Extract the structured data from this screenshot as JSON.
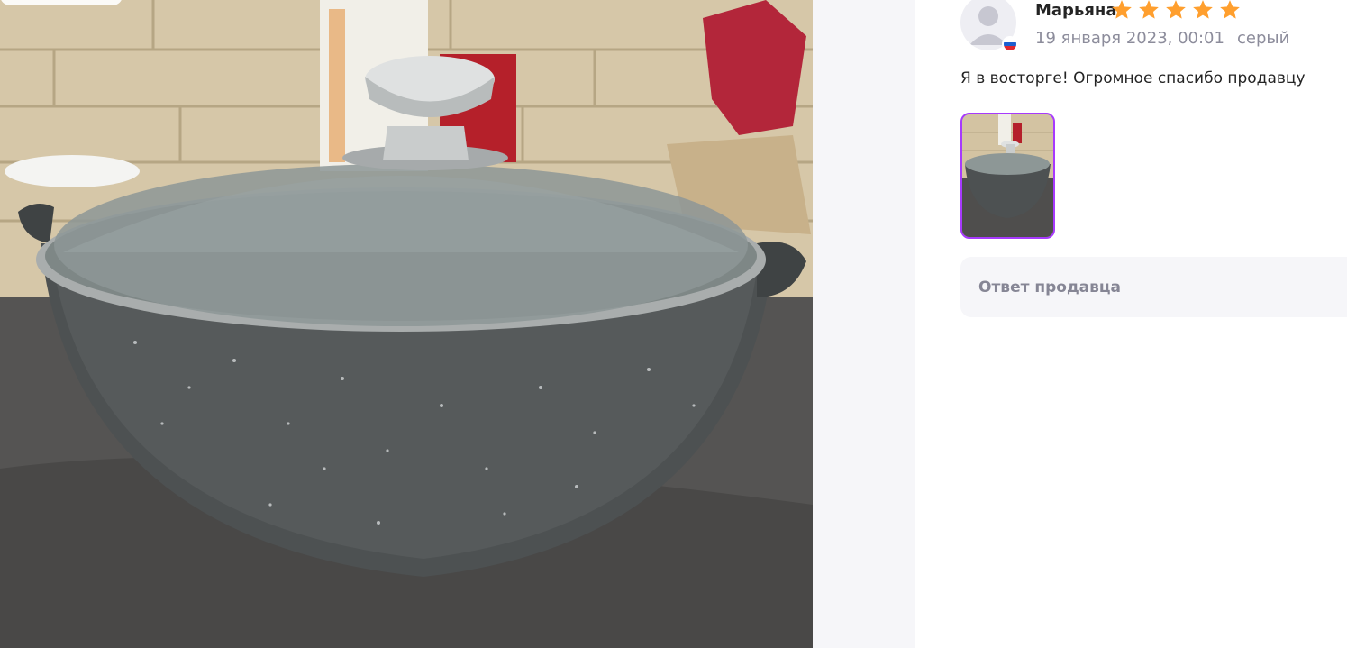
{
  "image_viewer": {
    "photo_alt": "review photo"
  },
  "review": {
    "author_name": "Марьяна",
    "rating": 5,
    "rating_max": 5,
    "date": "19 января 2023, 00:01",
    "color": "серый",
    "country_flag": "russia-flag-icon",
    "text": "Я в восторге! Огромное спасибо продавцу",
    "thumbnail_selected": true,
    "seller_reply_label": "Ответ продавца"
  },
  "colors": {
    "star": "#ff9f2e",
    "accent_border": "#a73afd",
    "meta_text": "#8c8c9b",
    "panel_bg": "#f6f6f9"
  }
}
